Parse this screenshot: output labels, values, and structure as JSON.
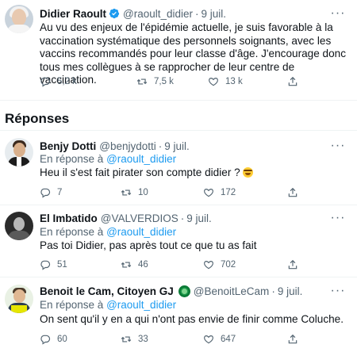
{
  "main_tweet": {
    "name": "Didier Raoult",
    "handle": "@raoult_didier",
    "date": "9 juil.",
    "text": "Au vu des enjeux de l'épidémie actuelle, je suis favorable à la vaccination systématique des personnels soignants, avec les vaccins recommandés pour leur classe d'âge. J'encourage donc tous mes collègues à se rapprocher de leur centre de vaccination.",
    "replies": "5,2 k",
    "retweets": "7,5 k",
    "likes": "13 k"
  },
  "replies_section": {
    "title": "Réponses"
  },
  "reply_prefix": "En réponse à",
  "replies": [
    {
      "name": "Benjy Dotti",
      "handle": "@benjydotti",
      "date": "9 juil.",
      "reply_to": "@raoult_didier",
      "text": "Heu il s'est fait pirater son compte didier ?",
      "replies": "7",
      "retweets": "10",
      "likes": "172"
    },
    {
      "name": "El Imbatido",
      "handle": "@VALVERDIOS",
      "date": "9 juil.",
      "reply_to": "@raoult_didier",
      "text": "Pas toi Didier, pas après tout ce que tu as fait",
      "replies": "51",
      "retweets": "46",
      "likes": "702"
    },
    {
      "name": "Benoit le Cam, Citoyen GJ",
      "handle": "@BenoitLeCam",
      "date": "9 juil.",
      "reply_to": "@raoult_didier",
      "text": "On sent qu'il y en a qui n'ont pas envie de finir comme Coluche.",
      "replies": "60",
      "retweets": "33",
      "likes": "647"
    }
  ],
  "icons": {
    "reply": "reply-icon",
    "retweet": "retweet-icon",
    "like": "like-icon",
    "share": "share-icon",
    "more": "more-icon",
    "verified": "verified-badge-icon"
  },
  "colors": {
    "text": "#0f1419",
    "secondary": "#536471",
    "accent": "#1d9bf0",
    "divider": "#eff3f4"
  }
}
